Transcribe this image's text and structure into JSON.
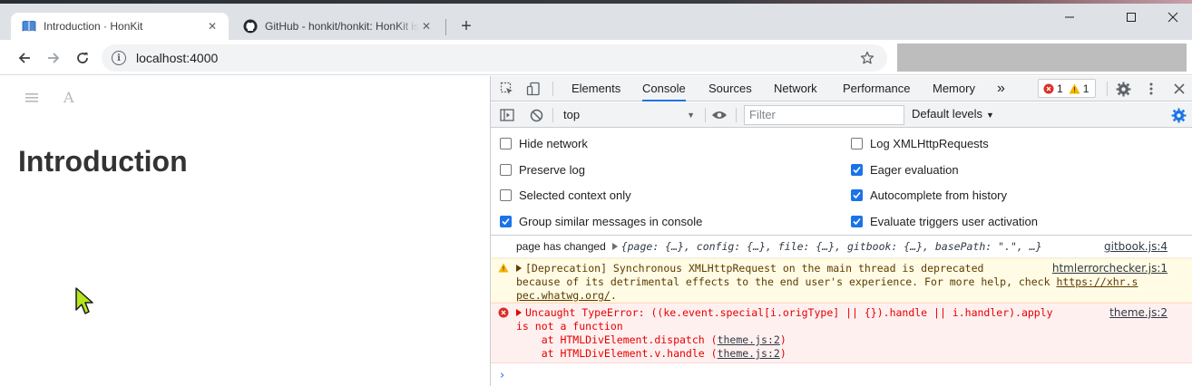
{
  "browser": {
    "tabs": [
      {
        "title": "Introduction · HonKit",
        "favicon": "book-icon",
        "active": true
      },
      {
        "title": "GitHub - honkit/honkit: HonKit is a modern static website generator",
        "favicon": "github-icon",
        "active": false
      }
    ],
    "address": "localhost:4000"
  },
  "page": {
    "heading": "Introduction"
  },
  "devtools": {
    "tabs": [
      "Elements",
      "Console",
      "Sources",
      "Network",
      "Performance",
      "Memory"
    ],
    "active_tab": "Console",
    "more_tabs": "»",
    "error_count": "1",
    "warning_count": "1",
    "context": "top",
    "filter_placeholder": "Filter",
    "levels": "Default levels",
    "settings": {
      "left": [
        {
          "label": "Hide network",
          "checked": false
        },
        {
          "label": "Preserve log",
          "checked": false
        },
        {
          "label": "Selected context only",
          "checked": false
        },
        {
          "label": "Group similar messages in console",
          "checked": true
        }
      ],
      "right": [
        {
          "label": "Log XMLHttpRequests",
          "checked": false
        },
        {
          "label": "Eager evaluation",
          "checked": true
        },
        {
          "label": "Autocomplete from history",
          "checked": true
        },
        {
          "label": "Evaluate triggers user activation",
          "checked": true
        }
      ]
    },
    "messages": {
      "log": {
        "text": "page has changed",
        "object": "{page: {…}, config: {…}, file: {…}, gitbook: {…}, basePath: \".\", …}",
        "source": "gitbook.js:4"
      },
      "warn": {
        "line1": "[Deprecation] Synchronous XMLHttpRequest on the main thread is deprecated",
        "line2": "because of its detrimental effects to the end user's experience. For more help, check ",
        "link_a": "https://xhr.s",
        "link_b": "pec.whatwg.org/",
        "line3_end": ".",
        "source": "htmlerrorchecker.js:1"
      },
      "error": {
        "line1": "Uncaught TypeError: ((ke.event.special[i.origType] || {}).handle || i.handler).apply",
        "line2": "is not a function",
        "stack1_pre": "    at HTMLDivElement.dispatch (",
        "stack1_link": "theme.js:2",
        "stack2_pre": "    at HTMLDivElement.v.handle (",
        "stack2_link": "theme.js:2",
        "stack_post": ")",
        "source": "theme.js:2"
      }
    },
    "prompt": "›"
  },
  "colors": {
    "accent": "#1a73e8",
    "error": "#e50000",
    "warning": "#f4b400",
    "warning_bg": "#fffbe5",
    "error_bg": "#fff0f0"
  }
}
